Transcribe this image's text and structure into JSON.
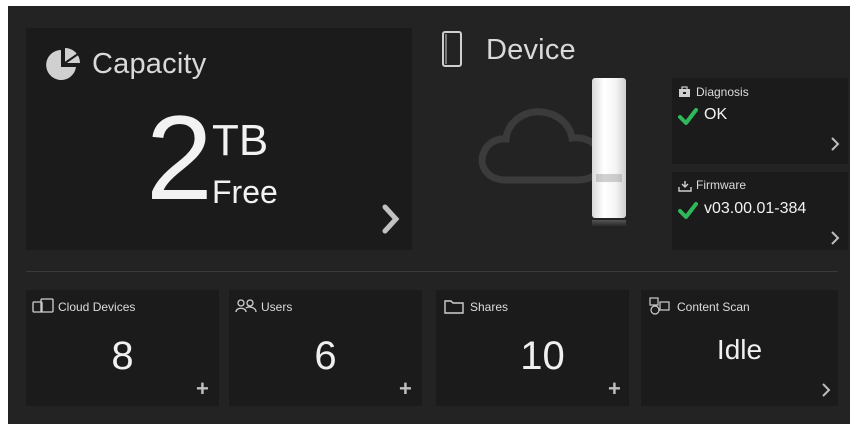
{
  "capacity": {
    "title": "Capacity",
    "amount": "2",
    "unit": "TB",
    "status": "Free"
  },
  "device": {
    "title": "Device",
    "diagnosis": {
      "label": "Diagnosis",
      "value": "OK"
    },
    "firmware": {
      "label": "Firmware",
      "value": "v03.00.01-384"
    }
  },
  "tiles": [
    {
      "label": "Cloud Devices",
      "value": "8",
      "action": "+"
    },
    {
      "label": "Users",
      "value": "6",
      "action": "+"
    },
    {
      "label": "Shares",
      "value": "10",
      "action": "+"
    },
    {
      "label": "Content Scan",
      "value": "Idle",
      "action": ">"
    }
  ],
  "colors": {
    "background": "#232323",
    "panel": "#1b1b1b",
    "check": "#2fb85a",
    "text": "#e6e6e6"
  },
  "icons": {
    "capacity": "pie-chart-icon",
    "device": "device-outline-icon",
    "diagnosis": "toolbox-icon",
    "firmware": "download-icon",
    "cloud_devices": "devices-icon",
    "users": "users-icon",
    "shares": "folder-icon",
    "content_scan": "content-scan-icon"
  }
}
